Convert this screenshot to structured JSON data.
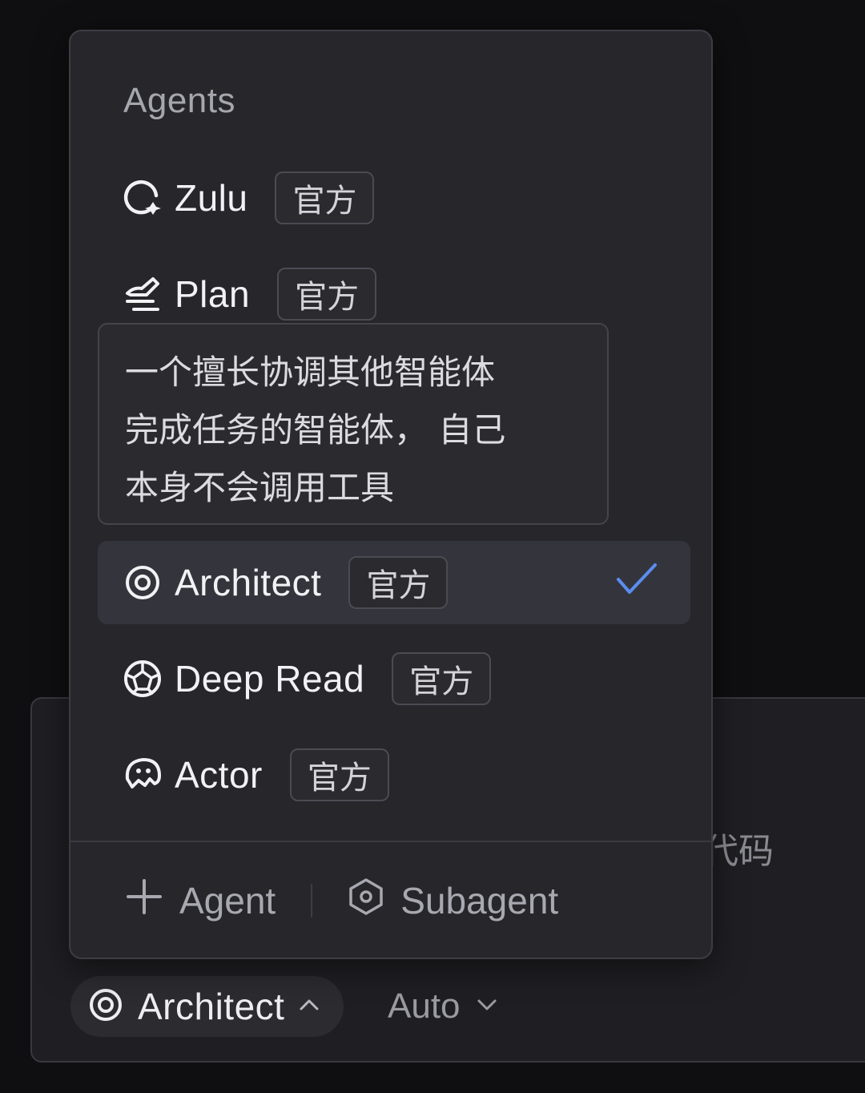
{
  "input_panel": {
    "placeholder_tail": "代码",
    "mode_selector": {
      "label": "Architect",
      "icon": "target-icon",
      "chevron": "chevron-up-icon"
    },
    "model_selector": {
      "label": "Auto",
      "chevron": "chevron-down-icon"
    }
  },
  "dropdown": {
    "section_title": "Agents",
    "agents": [
      {
        "name": "Zulu",
        "badge": "官方",
        "icon": "zulu-icon",
        "selected": false
      },
      {
        "name": "Plan",
        "badge": "官方",
        "icon": "plan-icon",
        "selected": false
      },
      {
        "name": "Architect",
        "badge": "官方",
        "icon": "target-icon",
        "selected": true
      },
      {
        "name": "Deep Read",
        "badge": "官方",
        "icon": "deep-read-icon",
        "selected": false
      },
      {
        "name": "Actor",
        "badge": "官方",
        "icon": "actor-icon",
        "selected": false
      }
    ],
    "tooltip": {
      "lines": [
        "一个擅长协调其他智能体",
        "完成任务的智能体， 自己",
        "本身不会调用工具"
      ]
    },
    "footer": {
      "add_agent_label": "Agent",
      "subagent_label": "Subagent"
    }
  },
  "colors": {
    "background": "#0f0f11",
    "panel": "#26262b",
    "selected_row": "#34353c",
    "check": "#5b8def"
  }
}
